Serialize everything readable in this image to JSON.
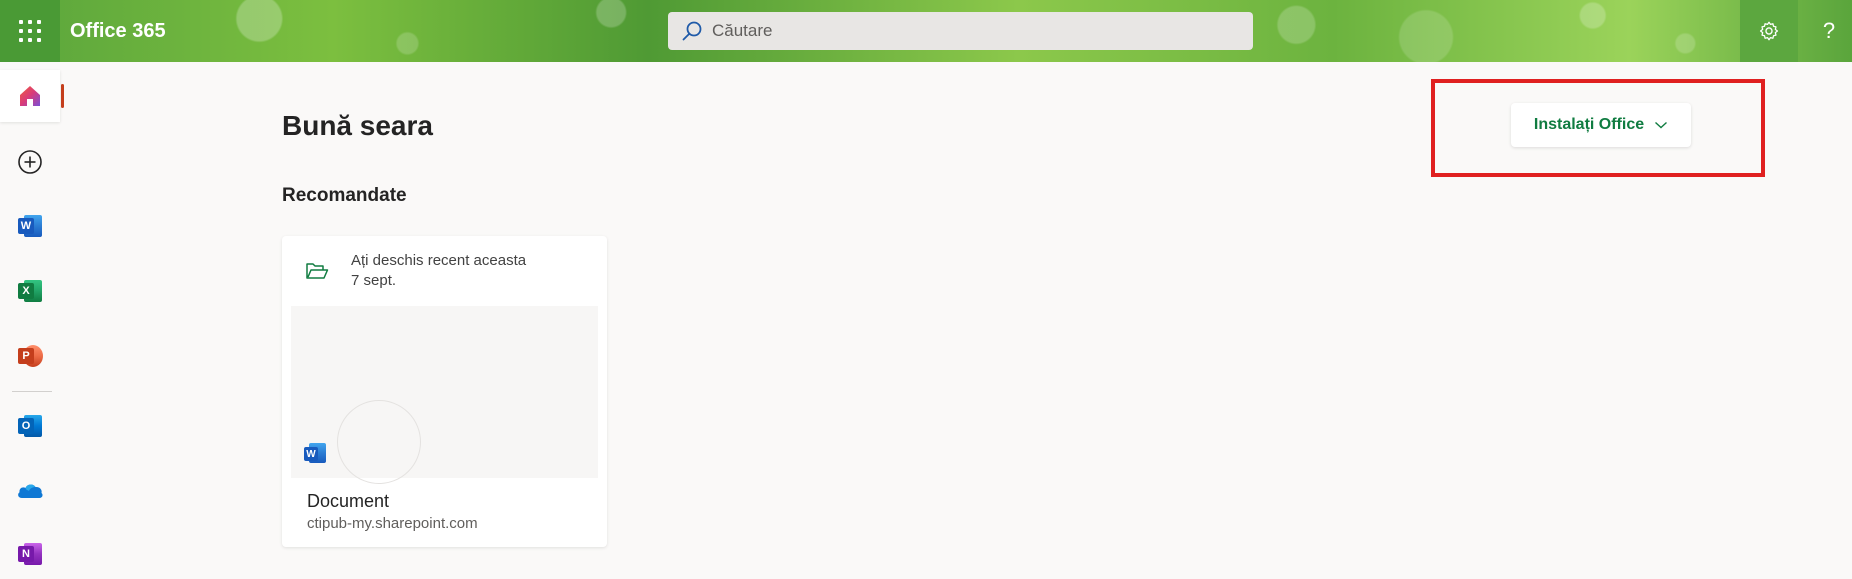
{
  "header": {
    "brand": "Office 365",
    "search_placeholder": "Căutare"
  },
  "rail": {
    "items": [
      "home",
      "create",
      "word",
      "excel",
      "powerpoint",
      "outlook",
      "onedrive",
      "onenote"
    ]
  },
  "main": {
    "greeting": "Bună seara",
    "section_title": "Recomandate",
    "install_label": "Instalați Office",
    "recommended": [
      {
        "line1": "Ați deschis recent aceasta",
        "line2": "7 sept.",
        "name": "Document",
        "location": "ctipub-my.sharepoint.com"
      }
    ]
  },
  "colors": {
    "accent_green": "#107c41",
    "highlight_red": "#e02020",
    "active_bar": "#c43e1c"
  }
}
